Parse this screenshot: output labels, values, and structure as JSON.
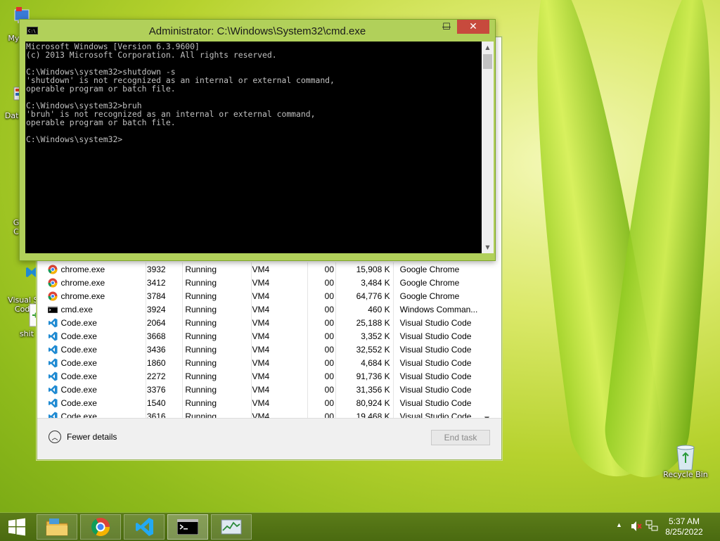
{
  "desktop": {
    "icons": [
      {
        "label": "My C"
      },
      {
        "label": "Data"
      },
      {
        "label": "G\nC"
      },
      {
        "label": "Visual St\nCode"
      },
      {
        "label": "shit"
      },
      {
        "label": "Recycle Bin"
      }
    ]
  },
  "cmd": {
    "title": "Administrator: C:\\Windows\\System32\\cmd.exe",
    "lines": [
      "Microsoft Windows [Version 6.3.9600]",
      "(c) 2013 Microsoft Corporation. All rights reserved.",
      "",
      "C:\\Windows\\system32>shutdown -s",
      "'shutdown' is not recognized as an internal or external command,",
      "operable program or batch file.",
      "",
      "C:\\Windows\\system32>bruh",
      "'bruh' is not recognized as an internal or external command,",
      "operable program or batch file.",
      "",
      "C:\\Windows\\system32>"
    ],
    "buttons": {
      "minimize": "—",
      "maximize": "☐",
      "close": "✕"
    }
  },
  "task_manager": {
    "rows": [
      {
        "icon": "chrome-icon",
        "name": "chrome.exe",
        "pid": "3932",
        "status": "Running",
        "user": "VM4",
        "cpu": "00",
        "memory": "15,908 K",
        "description": "Google Chrome"
      },
      {
        "icon": "chrome-icon",
        "name": "chrome.exe",
        "pid": "3412",
        "status": "Running",
        "user": "VM4",
        "cpu": "00",
        "memory": "3,484 K",
        "description": "Google Chrome"
      },
      {
        "icon": "chrome-icon",
        "name": "chrome.exe",
        "pid": "3784",
        "status": "Running",
        "user": "VM4",
        "cpu": "00",
        "memory": "64,776 K",
        "description": "Google Chrome"
      },
      {
        "icon": "cmd-icon",
        "name": "cmd.exe",
        "pid": "3924",
        "status": "Running",
        "user": "VM4",
        "cpu": "00",
        "memory": "460 K",
        "description": "Windows Comman..."
      },
      {
        "icon": "vscode-icon",
        "name": "Code.exe",
        "pid": "2064",
        "status": "Running",
        "user": "VM4",
        "cpu": "00",
        "memory": "25,188 K",
        "description": "Visual Studio Code"
      },
      {
        "icon": "vscode-icon",
        "name": "Code.exe",
        "pid": "3668",
        "status": "Running",
        "user": "VM4",
        "cpu": "00",
        "memory": "3,352 K",
        "description": "Visual Studio Code"
      },
      {
        "icon": "vscode-icon",
        "name": "Code.exe",
        "pid": "3436",
        "status": "Running",
        "user": "VM4",
        "cpu": "00",
        "memory": "32,552 K",
        "description": "Visual Studio Code"
      },
      {
        "icon": "vscode-icon",
        "name": "Code.exe",
        "pid": "1860",
        "status": "Running",
        "user": "VM4",
        "cpu": "00",
        "memory": "4,684 K",
        "description": "Visual Studio Code"
      },
      {
        "icon": "vscode-icon",
        "name": "Code.exe",
        "pid": "2272",
        "status": "Running",
        "user": "VM4",
        "cpu": "00",
        "memory": "91,736 K",
        "description": "Visual Studio Code"
      },
      {
        "icon": "vscode-icon",
        "name": "Code.exe",
        "pid": "3376",
        "status": "Running",
        "user": "VM4",
        "cpu": "00",
        "memory": "31,356 K",
        "description": "Visual Studio Code"
      },
      {
        "icon": "vscode-icon",
        "name": "Code.exe",
        "pid": "1540",
        "status": "Running",
        "user": "VM4",
        "cpu": "00",
        "memory": "80,924 K",
        "description": "Visual Studio Code"
      },
      {
        "icon": "vscode-icon",
        "name": "Code.exe",
        "pid": "3616",
        "status": "Running",
        "user": "VM4",
        "cpu": "00",
        "memory": "19,468 K",
        "description": "Visual Studio Code"
      }
    ],
    "fewer_details_label": "Fewer details",
    "end_task_label": "End task"
  },
  "taskbar": {
    "start_icon": "windows-logo-icon",
    "pinned": [
      {
        "name": "file-explorer",
        "icon": "folder-icon"
      },
      {
        "name": "chrome",
        "icon": "chrome-icon"
      },
      {
        "name": "vscode",
        "icon": "vscode-icon"
      },
      {
        "name": "cmd",
        "icon": "cmd-icon"
      },
      {
        "name": "task-manager",
        "icon": "task-manager-icon"
      }
    ],
    "clock": {
      "time": "5:37 AM",
      "date": "8/25/2022"
    }
  },
  "colors": {
    "cmd_frame": "#b1d05a",
    "close_button": "#c74a3d",
    "taskbar": "#4f6f13"
  }
}
